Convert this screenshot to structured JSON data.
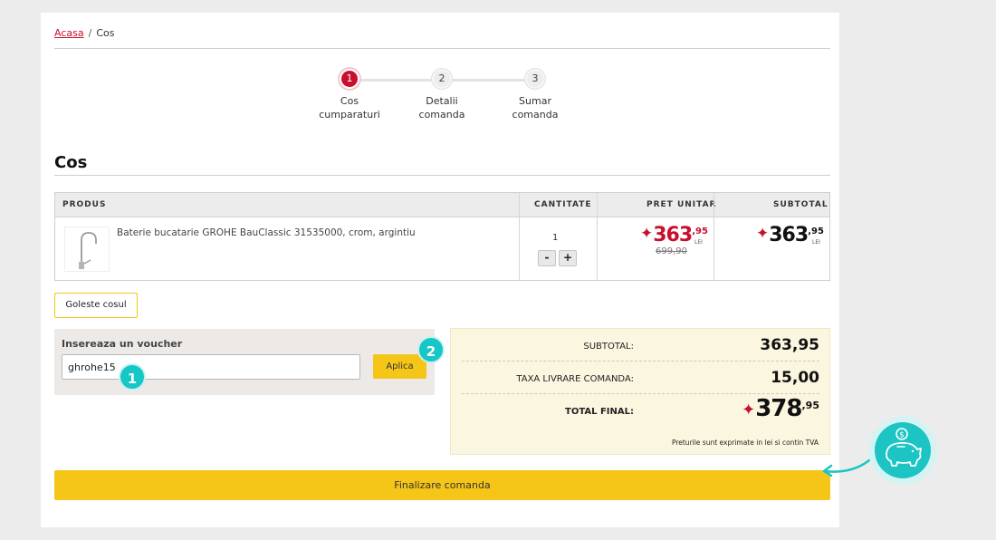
{
  "breadcrumb": {
    "home": "Acasa",
    "separator": "/",
    "current": "Cos"
  },
  "steps": [
    {
      "number": "1",
      "line1": "Cos",
      "line2": "cumparaturi",
      "active": true
    },
    {
      "number": "2",
      "line1": "Detalii",
      "line2": "comanda",
      "active": false
    },
    {
      "number": "3",
      "line1": "Sumar",
      "line2": "comanda",
      "active": false
    }
  ],
  "page_title": "Cos",
  "table": {
    "headers": {
      "product": "PRODUS",
      "quantity": "CANTITATE",
      "unit_price": "PRET UNITAR",
      "subtotal": "SUBTOTAL"
    },
    "rows": [
      {
        "product_name": "Baterie bucatarie GROHE BauClassic 31535000, crom, argintiu",
        "quantity": "1",
        "minus": "-",
        "plus": "+",
        "unit_price_int": "363",
        "unit_price_cents": ",95",
        "unit_price_currency": "LEI",
        "old_price": "699,90",
        "subtotal_int": "363",
        "subtotal_cents": ",95",
        "subtotal_currency": "LEI"
      }
    ]
  },
  "empty_cart_button": "Goleste cosul",
  "voucher": {
    "title": "Insereaza un voucher",
    "value": "ghrohe15",
    "apply_button": "Aplica"
  },
  "callouts": {
    "one": "1",
    "two": "2"
  },
  "summary": {
    "subtotal_label": "SUBTOTAL:",
    "subtotal_value": "363,95",
    "shipping_label": "TAXA LIVRARE COMANDA:",
    "shipping_value": "15,00",
    "total_label": "TOTAL FINAL:",
    "total_int": "378",
    "total_cents": ",95",
    "note": "Preturile sunt exprimate in lei si contin TVA"
  },
  "finalize_button": "Finalizare comanda",
  "colors": {
    "accent_red": "#c8102e",
    "accent_yellow": "#f5c518",
    "teal": "#17c6c6"
  },
  "icons": {
    "price_star": "sparkle-star-icon",
    "savings": "piggy-bank-icon",
    "pointer": "curved-arrow-icon"
  }
}
